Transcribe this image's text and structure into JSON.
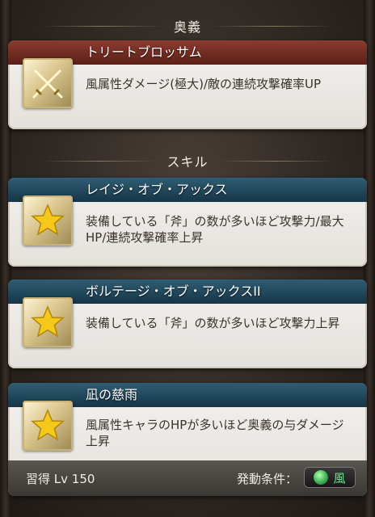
{
  "ougi_section": {
    "title": "奥義"
  },
  "skill_section": {
    "title": "スキル"
  },
  "ougi": {
    "name": "トリートブロッサム",
    "description": "風属性ダメージ(極大)/敵の連続攻撃確率UP",
    "icon": "crossed-swords-icon"
  },
  "skills": [
    {
      "name": "レイジ・オブ・アックス",
      "description": "装備している「斧」の数が多いほど攻撃力/最大HP/連続攻撃確率上昇",
      "icon": "star-icon"
    },
    {
      "name": "ボルテージ・オブ・アックスII",
      "description": "装備している「斧」の数が多いほど攻撃力上昇",
      "icon": "star-icon"
    },
    {
      "name": "凪の慈雨",
      "description": "風属性キャラのHPが多いほど奥義の与ダメージ上昇",
      "icon": "star-icon"
    }
  ],
  "footer": {
    "learn_level": "習得 Lv 150",
    "condition_label": "発動条件：",
    "condition_value": "風",
    "condition_icon": "wind-element-icon"
  },
  "colors": {
    "ougi_title_bg": "#6e2a20",
    "skill_title_bg": "#1f4458",
    "wind_green": "#3cb254"
  }
}
